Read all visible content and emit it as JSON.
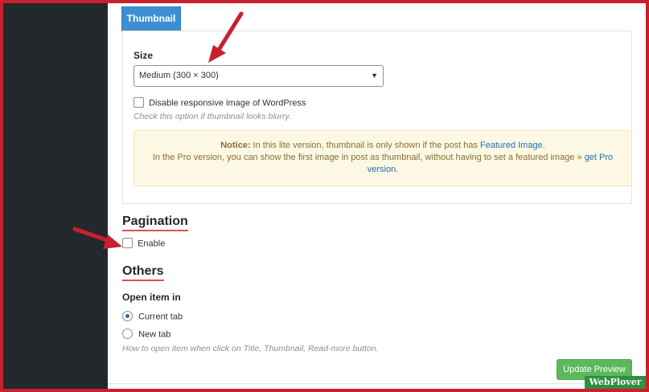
{
  "tab": {
    "label": "Thumbnail"
  },
  "thumbnail": {
    "size_label": "Size",
    "size_value": "Medium (300 × 300)",
    "disable_responsive_label": "Disable responsive image of WordPress",
    "disable_responsive_hint": "Check this option if thumbnail looks blurry.",
    "notice": {
      "title": "Notice:",
      "text_1": " In this lite version, thumbnail is only shown if the post has ",
      "link_1": "Featured Image",
      "text_2": ".",
      "text_3": "In the Pro version, you can show the first image in post as thumbnail, without having to set a featured image » ",
      "link_2": "get Pro version",
      "text_4": "."
    }
  },
  "pagination": {
    "title": "Pagination",
    "enable_label": "Enable"
  },
  "others": {
    "title": "Others",
    "open_item_label": "Open item in",
    "options": [
      {
        "label": "Current tab",
        "checked": true
      },
      {
        "label": "New tab",
        "checked": false
      }
    ],
    "hint": "How to open item when click on Title, Thumbnail, Read-more button."
  },
  "buttons": {
    "update_preview": "Update Preview"
  },
  "watermark": {
    "text": "WebPlover"
  },
  "colors": {
    "accent_tab": "#3d8fd1",
    "button_green": "#5cb85c",
    "underline_red": "#d9534f",
    "frame_red": "#c8202c",
    "sidebar": "#23282d",
    "notice_bg": "#fcf8e3"
  }
}
